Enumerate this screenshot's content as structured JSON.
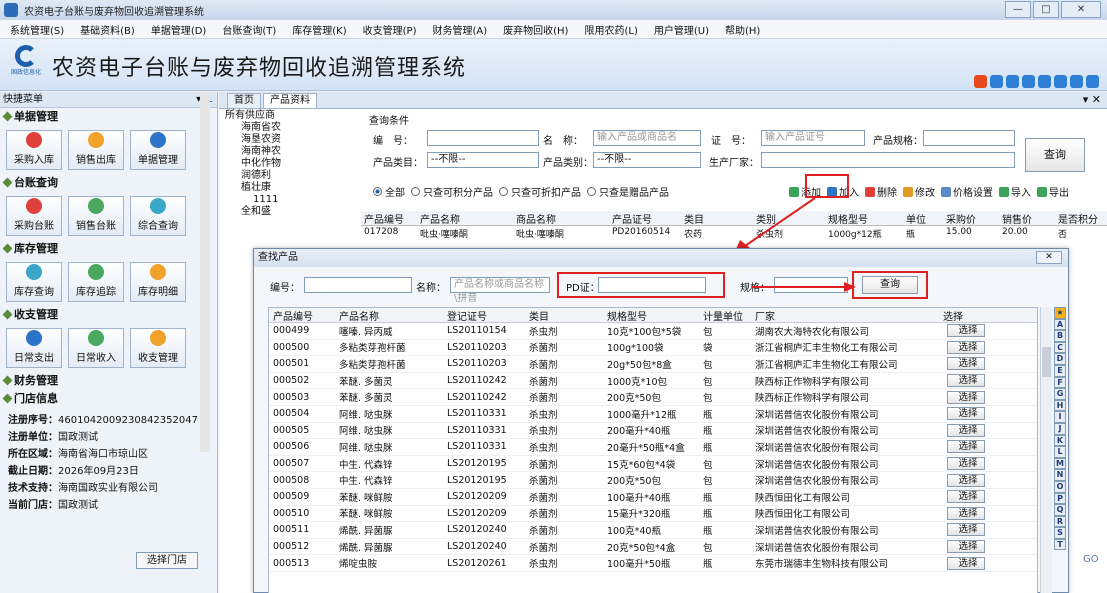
{
  "window": {
    "title": "农资电子台账与废弃物回收追溯管理系统",
    "btn_min": "—",
    "btn_max": "□",
    "btn_close": "✕"
  },
  "menu": [
    "系统管理(S)",
    "基础资料(B)",
    "单据管理(D)",
    "台账查询(T)",
    "库存管理(K)",
    "收支管理(P)",
    "财务管理(A)",
    "废弃物回收(H)",
    "限用农药(L)",
    "用户管理(U)",
    "帮助(H)"
  ],
  "banner": {
    "title": "农资电子台账与废弃物回收追溯管理系统",
    "logo_text": "国政信息化"
  },
  "sidebar": {
    "header": "快捷菜单",
    "sections": [
      {
        "title": "单据管理",
        "buttons": [
          "采购入库",
          "销售出库",
          "单据管理"
        ]
      },
      {
        "title": "台账查询",
        "buttons": [
          "采购台账",
          "销售台账",
          "综合查询"
        ]
      },
      {
        "title": "库存管理",
        "buttons": [
          "库存查询",
          "库存追踪",
          "库存明细"
        ]
      },
      {
        "title": "收支管理",
        "buttons": [
          "日常支出",
          "日常收入",
          "收支管理"
        ]
      }
    ],
    "finance": "财务管理",
    "store_section": "门店信息",
    "store": {
      "reg_no_label": "注册序号：",
      "reg_no": "460104200923084235​2047",
      "reg_unit_label": "注册单位：",
      "reg_unit": "国政测试",
      "region_label": "所在区域：",
      "region": "海南省海口市琼山区",
      "expire_label": "截止日期：",
      "expire": "2026年09月23日",
      "support_label": "技术支持：",
      "support": "海南国政实业有限公司",
      "current_label": "当前门店：",
      "current": "国政测试",
      "select_btn": "选择门店"
    }
  },
  "tabs": [
    "首页",
    "产品资料"
  ],
  "tree": [
    "所有供应商",
    "海南省农",
    "海垦农资",
    "海南神农",
    "中化作物",
    "润德利",
    "植壮康",
    "1111",
    "全和盛"
  ],
  "query": {
    "title": "查询条件",
    "code_label": "编　号：",
    "name_label": "名　称：",
    "name_placeholder": "输入产品或商品名",
    "cert_label": "证　号：",
    "cert_placeholder": "输入产品证号",
    "spec_label": "产品规格：",
    "category_label": "产品类目：",
    "category_value": "--不限--",
    "type_label": "产品类别：",
    "type_value": "--不限--",
    "maker_label": "生产厂家：",
    "search_btn": "查询",
    "radios": [
      "全部",
      "只查可积分产品",
      "只查可折扣产品",
      "只查是赠品产品"
    ],
    "tools": [
      "添加",
      "加入",
      "删除",
      "修改",
      "价格设置",
      "导入",
      "导出"
    ]
  },
  "grid": {
    "headers": [
      "产品编号",
      "产品名称",
      "商品名称",
      "产品证号",
      "类目",
      "类别",
      "规格型号",
      "单位",
      "采购价",
      "销售价",
      "是否积分"
    ],
    "row": [
      "017208",
      "吡虫·噻嗪酮",
      "吡虫·噻嗪酮",
      "PD20160514",
      "农药",
      "杀虫剂",
      "1000g*12瓶",
      "瓶",
      "15.00",
      "20.00",
      "否"
    ]
  },
  "dialog": {
    "title": "查找产品",
    "close": "✕",
    "code_label": "编号：",
    "name_label": "名称：",
    "name_placeholder": "产品名称或商品名称\\拼音",
    "pd_label": "PD证：",
    "spec_label": "规格：",
    "search_btn": "查询",
    "headers": [
      "产品编号",
      "产品名称",
      "登记证号",
      "类目",
      "规格型号",
      "计量单位",
      "厂家",
      "选择"
    ],
    "pick_label": "选择",
    "rows": [
      [
        "000499",
        "噻嗪. 异丙威",
        "LS20110154",
        "杀虫剂",
        "10克*100包*5袋",
        "包",
        "湖南农大海特农化有限公司"
      ],
      [
        "000500",
        "多粘类芽孢杆菌",
        "LS20110203",
        "杀菌剂",
        "100g*100袋",
        "袋",
        "浙江省桐庐汇丰生物化工有限公司"
      ],
      [
        "000501",
        "多粘类芽孢杆菌",
        "LS20110203",
        "杀菌剂",
        "20g*50包*8盒",
        "包",
        "浙江省桐庐汇丰生物化工有限公司"
      ],
      [
        "000502",
        "苯醚. 多菌灵",
        "LS20110242",
        "杀菌剂",
        "1000克*10包",
        "包",
        "陕西标正作物科学有限公司"
      ],
      [
        "000503",
        "苯醚. 多菌灵",
        "LS20110242",
        "杀菌剂",
        "200克*50包",
        "包",
        "陕西标正作物科学有限公司"
      ],
      [
        "000504",
        "阿维. 哒虫脒",
        "LS20110331",
        "杀虫剂",
        "1000毫升*12瓶",
        "瓶",
        "深圳诺普信农化股份有限公司"
      ],
      [
        "000505",
        "阿维. 哒虫脒",
        "LS20110331",
        "杀虫剂",
        "200毫升*40瓶",
        "瓶",
        "深圳诺普信农化股份有限公司"
      ],
      [
        "000506",
        "阿维. 哒虫脒",
        "LS20110331",
        "杀虫剂",
        "20毫升*50瓶*4盒",
        "瓶",
        "深圳诺普信农化股份有限公司"
      ],
      [
        "000507",
        "中生. 代森锌",
        "LS20120195",
        "杀菌剂",
        "15克*60包*4袋",
        "包",
        "深圳诺普信农化股份有限公司"
      ],
      [
        "000508",
        "中生. 代森锌",
        "LS20120195",
        "杀菌剂",
        "200克*50包",
        "包",
        "深圳诺普信农化股份有限公司"
      ],
      [
        "000509",
        "苯醚. 咪鲜胺",
        "LS20120209",
        "杀菌剂",
        "100毫升*40瓶",
        "瓶",
        "陕西恒田化工有限公司"
      ],
      [
        "000510",
        "苯醚. 咪鲜胺",
        "LS20120209",
        "杀菌剂",
        "15毫升*320瓶",
        "瓶",
        "陕西恒田化工有限公司"
      ],
      [
        "000511",
        "烯酰. 异菌脲",
        "LS20120240",
        "杀菌剂",
        "100克*40瓶",
        "瓶",
        "深圳诺普信农化股份有限公司"
      ],
      [
        "000512",
        "烯酰. 异菌脲",
        "LS20120240",
        "杀菌剂",
        "20克*50包*4盒",
        "包",
        "深圳诺普信农化股份有限公司"
      ],
      [
        "000513",
        "烯啶虫胺",
        "LS20120261",
        "杀虫剂",
        "100毫升*50瓶",
        "瓶",
        "东莞市瑞德丰生物科技有限公司"
      ]
    ],
    "alpha": [
      "★",
      "A",
      "B",
      "C",
      "D",
      "E",
      "F",
      "G",
      "H",
      "I",
      "J",
      "K",
      "L",
      "M",
      "N",
      "O",
      "P",
      "Q",
      "R",
      "S",
      "T"
    ]
  },
  "go_label": "GO",
  "colors": {
    "accent": "#1b5fa8",
    "highlight": "#e02020"
  }
}
